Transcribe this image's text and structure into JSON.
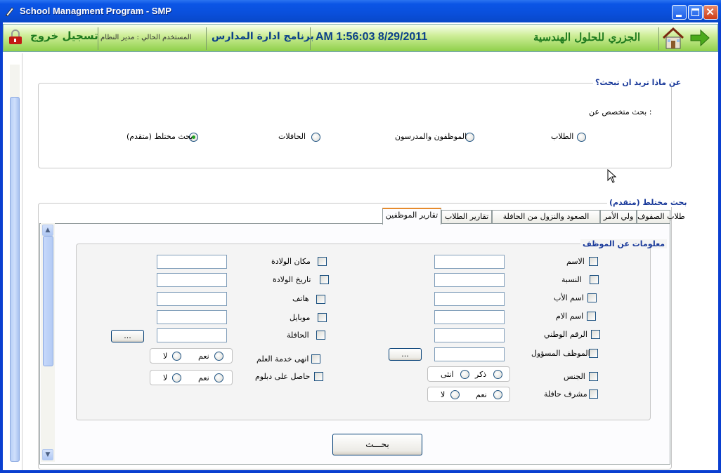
{
  "window": {
    "title": "School Managment Program - SMP",
    "app_icon": "pen-icon",
    "controls": [
      "minimize-icon",
      "maximize-icon",
      "close-icon"
    ]
  },
  "header": {
    "logout_label": "تسجيل خروج",
    "current_user": "المستخدم الحالي : مدير النظام",
    "program_name": "برنامج ادارة المدارس",
    "datetime": "AM 1:56:03 8/29/2011",
    "company": "الجزري للحلول الهندسية",
    "icons": [
      "lock-icon",
      "home-icon",
      "arrow-right-icon"
    ],
    "colors": {
      "green_text": "#1e7a1e",
      "blue_text": "#0a3f8a"
    }
  },
  "search_group": {
    "title": "عن ماذا تريد ان تبحث؟",
    "subtitle": "بحث متخصص عن :",
    "options": [
      {
        "label": "الطلاب",
        "selected": false
      },
      {
        "label": "الموظفون والمدرسون",
        "selected": false
      },
      {
        "label": "الحافلات",
        "selected": false
      },
      {
        "label": "بحث مختلط (متقدم)",
        "selected": true
      }
    ]
  },
  "advanced": {
    "title": "بحث مختلط (متقدم)",
    "tabs": [
      {
        "label": "طلاب الصفوف",
        "active": false
      },
      {
        "label": "ولي الأمر",
        "active": false
      },
      {
        "label": "الصعود والنزول من الحافلة",
        "active": false
      },
      {
        "label": "تقارير الطلاب",
        "active": false
      },
      {
        "label": "تقارير الموظفين",
        "active": true
      }
    ]
  },
  "employee_panel": {
    "title": "معلومات عن الموظف",
    "right_fields": [
      "الاسم",
      "النسبة",
      "اسم الأب",
      "اسم الام",
      "الرقم الوطني",
      "الموظف المسؤول"
    ],
    "right_extra": [
      "الجنس",
      "مشرف حافلة"
    ],
    "gender_options": [
      "ذكر",
      "انثى"
    ],
    "yes_no": [
      "نعم",
      "لا"
    ],
    "left_fields": [
      "مكان الولادة",
      "تاريخ الولادة",
      "هاتف",
      "موبايل",
      "الحافلة"
    ],
    "left_extra": [
      "انهى خدمة العلم",
      "حاصل على دبلوم"
    ],
    "browse_label": "...",
    "search_button": "بحـــث"
  }
}
